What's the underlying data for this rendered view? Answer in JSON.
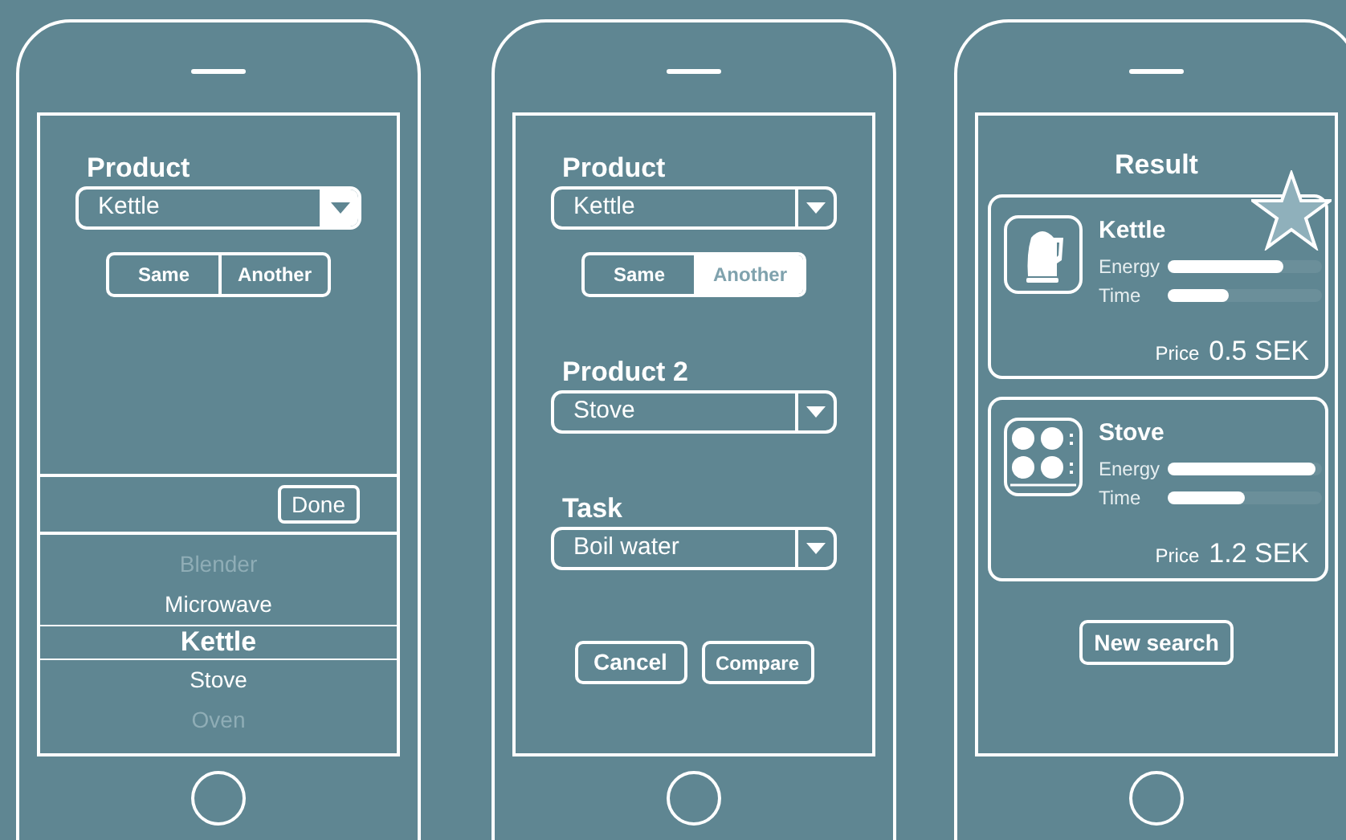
{
  "phones": [
    {
      "kind": "select",
      "fields": [
        {
          "label": "Product",
          "value": "Kettle",
          "open": true
        }
      ],
      "toggle": [
        {
          "label": "Same",
          "selected": false
        },
        {
          "label": "Another",
          "selected": false
        }
      ],
      "done_button": "Done",
      "picker": [
        {
          "label": "Blender",
          "selected": false,
          "dim": true
        },
        {
          "label": "Microwave",
          "selected": false,
          "dim": false
        },
        {
          "label": "Kettle",
          "selected": true,
          "dim": false
        },
        {
          "label": "Stove",
          "selected": false,
          "dim": false
        },
        {
          "label": "Oven",
          "selected": false,
          "dim": true
        }
      ]
    },
    {
      "kind": "compare",
      "fields": [
        {
          "label": "Product",
          "value": "Kettle",
          "open": false
        },
        {
          "label": "Product 2",
          "value": "Stove",
          "open": false
        },
        {
          "label": "Task",
          "value": "Boil water",
          "open": false
        }
      ],
      "toggle": [
        {
          "label": "Same",
          "selected": false
        },
        {
          "label": "Another",
          "selected": true
        }
      ],
      "buttons": [
        "Cancel",
        "Compare"
      ]
    },
    {
      "kind": "result",
      "title": "Result",
      "results": [
        {
          "name": "Kettle",
          "kind": "kettle",
          "starred": true,
          "metrics": [
            {
              "label": "Energy",
              "level": 0.75
            },
            {
              "label": "Time",
              "level": 0.4
            }
          ],
          "price_label": "Price",
          "price": "0.5 SEK"
        },
        {
          "name": "Stove",
          "kind": "stove",
          "starred": false,
          "metrics": [
            {
              "label": "Energy",
              "level": 0.96
            },
            {
              "label": "Time",
              "level": 0.5
            }
          ],
          "price_label": "Price",
          "price": "1.2 SEK"
        }
      ],
      "button": "New search"
    }
  ]
}
